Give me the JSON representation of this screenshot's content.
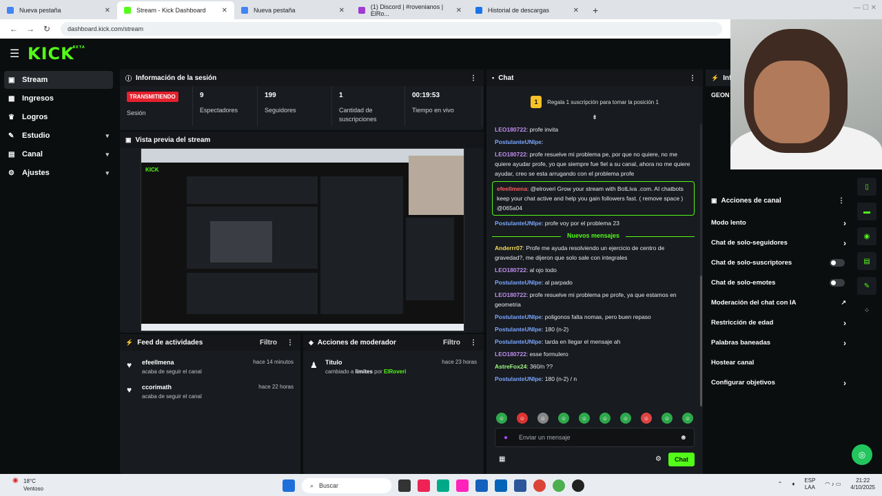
{
  "browser": {
    "tabs": [
      {
        "label": "Nueva pestaña",
        "color": "#4285f4"
      },
      {
        "label": "Stream - Kick Dashboard",
        "color": "#53fc18"
      },
      {
        "label": "Nueva pestaña",
        "color": "#4285f4"
      },
      {
        "label": "(1) Discord | #rovenianos | ElRo...",
        "color": "#a13bd3"
      },
      {
        "label": "Historial de descargas",
        "color": "#1a73e8"
      }
    ],
    "url": "dashboard.kick.com/stream"
  },
  "app": {
    "logo": "KICK",
    "logo_sup": "BETA",
    "sidebar": [
      {
        "label": "Stream",
        "icon": "video-icon",
        "glyph": "▣",
        "chev": ""
      },
      {
        "label": "Ingresos",
        "icon": "revenue-icon",
        "glyph": "▦",
        "chev": ""
      },
      {
        "label": "Logros",
        "icon": "trophy-icon",
        "glyph": "♛",
        "chev": ""
      },
      {
        "label": "Estudio",
        "icon": "studio-icon",
        "glyph": "✎",
        "chev": "▾"
      },
      {
        "label": "Canal",
        "icon": "channel-icon",
        "glyph": "▤",
        "chev": "▾"
      },
      {
        "label": "Ajustes",
        "icon": "gear-icon",
        "glyph": "⚙",
        "chev": "▾"
      }
    ]
  },
  "session": {
    "title": "Información de la sesión",
    "status": "TRANSMITIENDO",
    "status_label": "Sesión",
    "stats": [
      {
        "value": "9",
        "label": "Espectadores"
      },
      {
        "value": "199",
        "label": "Seguidores"
      },
      {
        "value": "1",
        "label": "Cantidad de suscripciones"
      },
      {
        "value": "00:19:53",
        "label": "Tiempo en vivo"
      }
    ]
  },
  "preview": {
    "title": "Vista previa del stream"
  },
  "feed": {
    "title": "Feed de actividades",
    "filter": "Filtro",
    "items": [
      {
        "name": "efeellmena",
        "action": "acaba de seguir el canal",
        "time": "hace 14 minutos"
      },
      {
        "name": "ccorimath",
        "action": "acaba de seguir el canal",
        "time": "hace 22 horas"
      }
    ]
  },
  "modactions": {
    "title": "Acciones de moderador",
    "filter": "Filtro",
    "items": [
      {
        "name": "Título",
        "pre": "cambiado a",
        "target": "limites",
        "mid": "por",
        "user": "ElRoveri",
        "time": "hace 23 horas"
      }
    ]
  },
  "chat": {
    "title": "Chat",
    "pinned_num": "1",
    "pinned": "Regala 1 suscripción para tomar la posición 1",
    "new_messages": "Nuevos mensajes",
    "messages_before": [
      {
        "user": "LEO180722",
        "text": ": profe invita",
        "cls": "u1"
      },
      {
        "user": "PostulanteUNIpe",
        "text": ":",
        "cls": "u2"
      },
      {
        "user": "LEO180722",
        "text": ": profe resuelve mi problema pe, por que no quiere, no me quiere ayudar profe, yo que siempre fue fiel a su canal, ahora no me quiere ayudar, creo se esta arrugando con el problema profe",
        "cls": "u1"
      },
      {
        "user": "efeellmena",
        "text": ": @elroveri Grow your stream with BotLiva .com. AI chatbots keep your chat active and help you gain followers fast. ( remove space ) @065a04",
        "cls": "u4",
        "hl": true
      },
      {
        "user": "PostulanteUNIpe",
        "text": ": profe voy por el problema 23",
        "cls": "u2"
      }
    ],
    "messages_after": [
      {
        "user": "Anderrr07",
        "text": ": Profe me ayuda resolviendo un ejercicio de centro de gravedad?, me dijeron que solo sale con integrales",
        "cls": "u3"
      },
      {
        "user": "LEO180722",
        "text": ": al ojo todo",
        "cls": "u1"
      },
      {
        "user": "PostulanteUNIpe",
        "text": ": al parpado",
        "cls": "u2"
      },
      {
        "user": "LEO180722",
        "text": ": profe resuelve mi problema pe profe, ya que estamos en geometria",
        "cls": "u1"
      },
      {
        "user": "PostulanteUNIpe",
        "text": ": poligonos falta nomas, pero buen repaso",
        "cls": "u2"
      },
      {
        "user": "PostulanteUNIpe",
        "text": ": 180 (n-2)",
        "cls": "u2"
      },
      {
        "user": "PostulanteUNIpe",
        "text": ": tarda en llegar el mensaje ah",
        "cls": "u2"
      },
      {
        "user": "LEO180722",
        "text": ": esse formulero",
        "cls": "u1"
      },
      {
        "user": "AstreFox24",
        "text": ": 360/n ??",
        "cls": "u5"
      },
      {
        "user": "PostulanteUNIpe",
        "text": ": 180 (n-2) / n",
        "cls": "u2"
      }
    ],
    "input_placeholder": "Enviar un mensaje",
    "send": "Chat"
  },
  "channel_actions": {
    "title": "Acciones de canal",
    "items": [
      {
        "label": "Modo lento",
        "kind": "arrow"
      },
      {
        "label": "Chat de solo-seguidores",
        "kind": "arrow"
      },
      {
        "label": "Chat de solo-suscriptores",
        "kind": "toggle"
      },
      {
        "label": "Chat de solo-emotes",
        "kind": "toggle"
      },
      {
        "label": "Moderación del chat con IA",
        "kind": "link"
      },
      {
        "label": "Restricción de edad",
        "kind": "arrow"
      },
      {
        "label": "Palabras baneadas",
        "kind": "arrow"
      },
      {
        "label": "Hostear canal",
        "kind": "none"
      },
      {
        "label": "Configurar objetivos",
        "kind": "arrow"
      }
    ]
  },
  "info_partial": {
    "title": "Info",
    "label": "GEON"
  },
  "taskbar": {
    "temp": "18°C",
    "weather": "Ventoso",
    "search": "Buscar",
    "lang1": "ESP",
    "lang2": "LAA",
    "time": "21:22",
    "date": "4/10/2025"
  }
}
